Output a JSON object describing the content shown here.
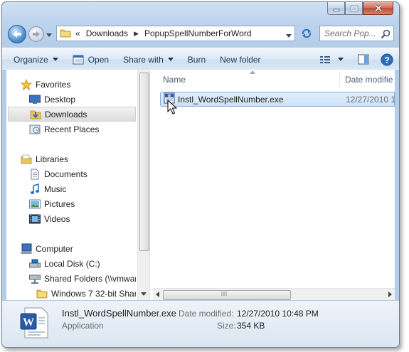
{
  "window": {
    "caption_buttons": [
      "minimize-icon",
      "maximize-icon",
      "close-icon"
    ]
  },
  "address_bar": {
    "overflow_marker": "«",
    "crumbs": [
      "Downloads",
      "PopupSpellNumberForWord"
    ],
    "separator": "▶"
  },
  "search": {
    "placeholder": "Search Pop..."
  },
  "toolbar": {
    "organize": "Organize",
    "open": "Open",
    "share_with": "Share with",
    "burn": "Burn",
    "new_folder": "New folder"
  },
  "nav_pane": {
    "favorites": "Favorites",
    "desktop": "Desktop",
    "downloads": "Downloads",
    "recent_places": "Recent Places",
    "libraries": "Libraries",
    "documents": "Documents",
    "music": "Music",
    "pictures": "Pictures",
    "videos": "Videos",
    "computer": "Computer",
    "local_disk": "Local Disk (C:)",
    "shared_folders": "Shared Folders (\\\\vmwar",
    "windows7": "Windows 7 32-bit Share"
  },
  "file_list": {
    "columns": {
      "name": "Name",
      "date_modified": "Date modifie"
    },
    "files": [
      {
        "name": "Instl_WordSpellNumber.exe",
        "date": "12/27/2010 1"
      }
    ]
  },
  "details_pane": {
    "file_name": "Instl_WordSpellNumber.exe",
    "file_type": "Application",
    "date_label": "Date modified:",
    "date_value": "12/27/2010 10:48 PM",
    "size_label": "Size:",
    "size_value": "354 KB"
  },
  "colors": {
    "selection_border": "#84acdd",
    "selection_fill": "#cde2f8",
    "chrome": "#bcd3ec",
    "close_button": "#c3492f"
  }
}
